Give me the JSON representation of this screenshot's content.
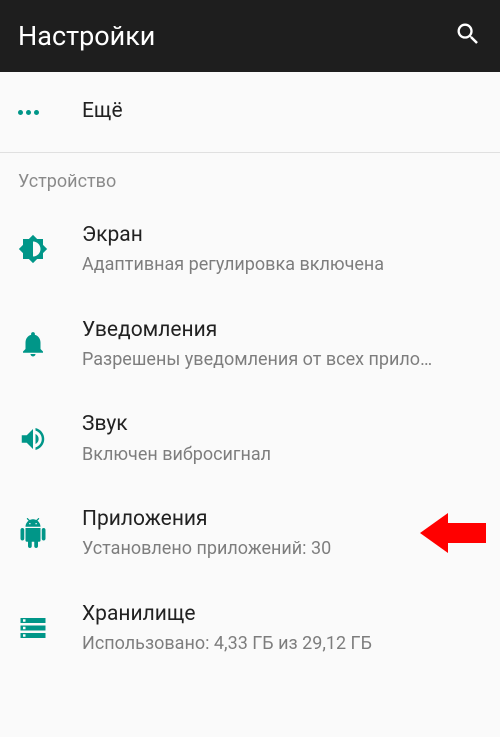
{
  "appbar": {
    "title": "Настройки"
  },
  "more": {
    "title": "Ещё"
  },
  "section": {
    "device": "Устройство"
  },
  "items": {
    "display": {
      "title": "Экран",
      "subtitle": "Адаптивная регулировка включена"
    },
    "notifications": {
      "title": "Уведомления",
      "subtitle": "Разрешены уведомления от всех прило…"
    },
    "sound": {
      "title": "Звук",
      "subtitle": "Включен вибросигнал"
    },
    "apps": {
      "title": "Приложения",
      "subtitle": "Установлено приложений: 30"
    },
    "storage": {
      "title": "Хранилище",
      "subtitle": "Использовано: 4,33 ГБ из 29,12 ГБ"
    }
  },
  "accent": "#009688"
}
